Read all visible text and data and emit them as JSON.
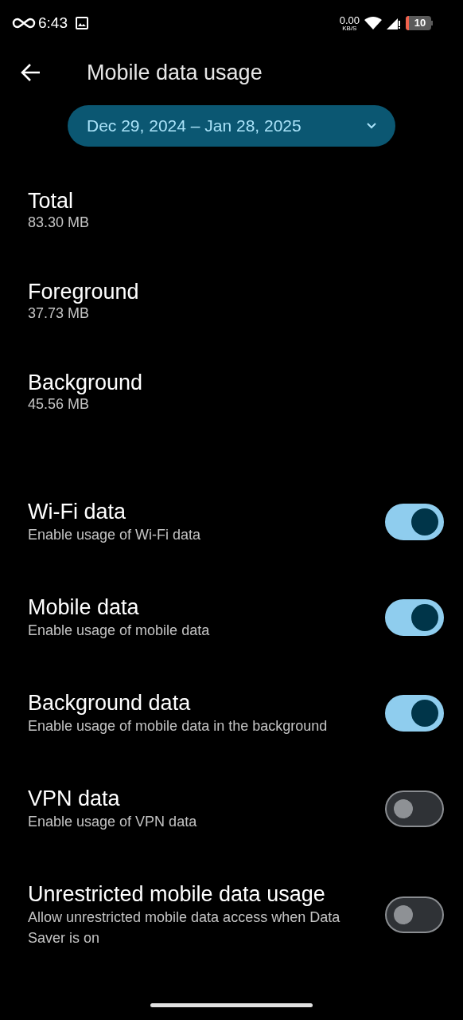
{
  "status_bar": {
    "time": "6:43",
    "speed": "0.00",
    "speed_unit": "KB/S",
    "battery": "10"
  },
  "header": {
    "title": "Mobile data usage"
  },
  "date_range": "Dec 29, 2024 – Jan 28, 2025",
  "usage": [
    {
      "label": "Total",
      "value": "83.30 MB"
    },
    {
      "label": "Foreground",
      "value": "37.73 MB"
    },
    {
      "label": "Background",
      "value": "45.56 MB"
    }
  ],
  "settings": [
    {
      "title": "Wi-Fi data",
      "summary": "Enable usage of Wi-Fi data",
      "on": true
    },
    {
      "title": "Mobile data",
      "summary": "Enable usage of mobile data",
      "on": true
    },
    {
      "title": "Background data",
      "summary": "Enable usage of mobile data in the background",
      "on": true
    },
    {
      "title": "VPN data",
      "summary": "Enable usage of VPN data",
      "on": false
    },
    {
      "title": "Unrestricted mobile data usage",
      "summary": "Allow unrestricted mobile data access when Data Saver is on",
      "on": false
    }
  ]
}
